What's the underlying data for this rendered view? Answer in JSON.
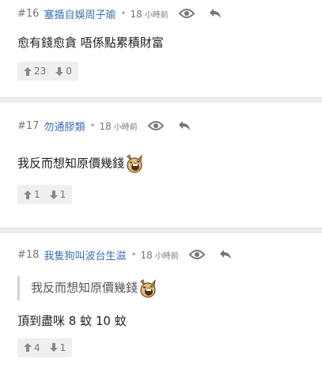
{
  "posts": [
    {
      "number": "#16",
      "username": "塞揗自娛周子瑜",
      "time_value": "18",
      "time_unit": "小時前",
      "content": "愈有錢愈貪 唔係點累積財富",
      "upvotes": "23",
      "downvotes": "0"
    },
    {
      "number": "#17",
      "username": "勿通膠類",
      "time_value": "18",
      "time_unit": "小時前",
      "content": "我反而想知原價幾錢",
      "upvotes": "1",
      "downvotes": "1"
    },
    {
      "number": "#18",
      "username": "我隻狗叫波台生滋",
      "time_value": "18",
      "time_unit": "小時前",
      "quote": "我反而想知原價幾錢",
      "content": "頂到盡咪 8 蚊 10 蚊",
      "upvotes": "4",
      "downvotes": "1"
    }
  ],
  "icons": {
    "view": "eye-icon",
    "reply": "reply-icon",
    "upvote": "arrow-up-icon",
    "downvote": "arrow-down-icon",
    "emoji": "laughing-face-sticker"
  },
  "colors": {
    "username": "#3c6fb0",
    "meta": "#777777",
    "vote_bg": "#efefef",
    "separator": "#ececec"
  }
}
